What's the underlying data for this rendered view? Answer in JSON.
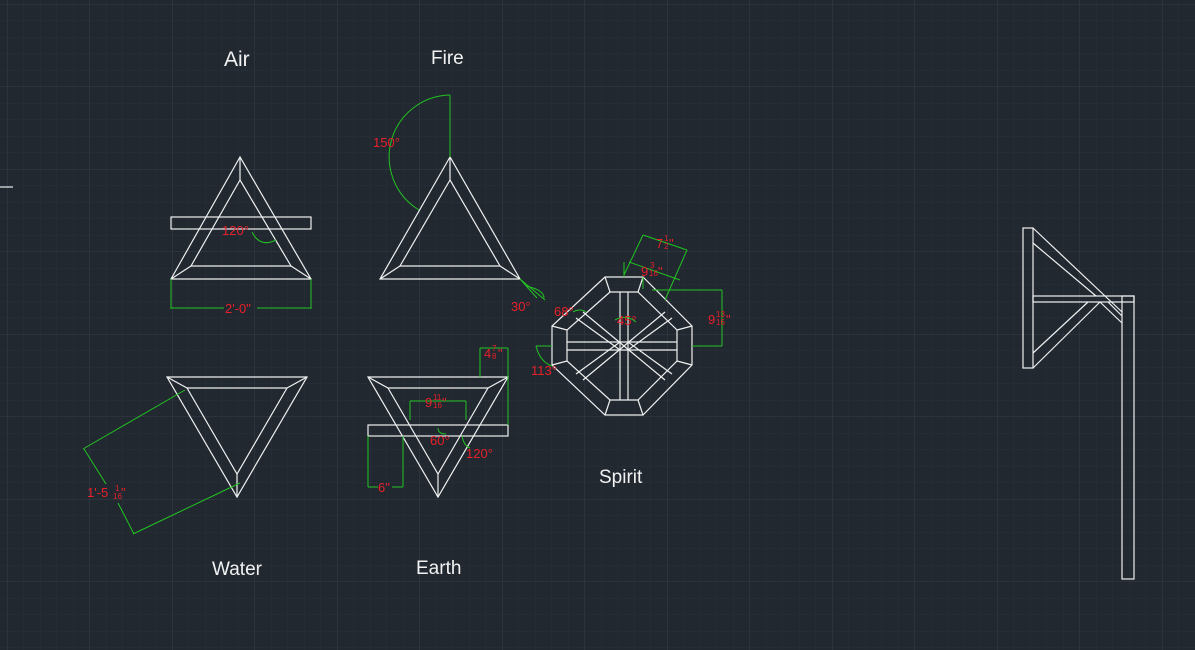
{
  "colors": {
    "background": "#212830",
    "grid_minor": "#2b323c",
    "grid_major": "#343c47",
    "geometry": "#f0f0f0",
    "dimension_line": "#22c422",
    "dimension_text": "#e8202a"
  },
  "labels": {
    "air": "Air",
    "fire": "Fire",
    "water": "Water",
    "earth": "Earth",
    "spirit": "Spirit"
  },
  "dimensions": {
    "air_angle": "120°",
    "air_width": "2'-0\"",
    "fire_angle_top": "150°",
    "fire_angle_bottom": "30°",
    "water_length_main": "1'-5",
    "water_length_frac_num": "1",
    "water_length_frac_den": "16",
    "earth_height_main": "4",
    "earth_height_frac_num": "7",
    "earth_height_frac_den": "8",
    "earth_bar_main": "9",
    "earth_bar_frac_num": "11",
    "earth_bar_frac_den": "16",
    "earth_angle_inner": "60°",
    "earth_angle_outer": "120°",
    "earth_offset": "6\"",
    "spirit_top_main": "7",
    "spirit_top_frac_num": "1",
    "spirit_top_frac_den": "2",
    "spirit_side_main": "9",
    "spirit_side_frac_num": "3",
    "spirit_side_frac_den": "16",
    "spirit_right_main": "9",
    "spirit_right_frac_num": "13",
    "spirit_right_frac_den": "16",
    "spirit_angle_inner": "45°",
    "spirit_angle_left": "68°",
    "spirit_angle_outer": "113°"
  }
}
